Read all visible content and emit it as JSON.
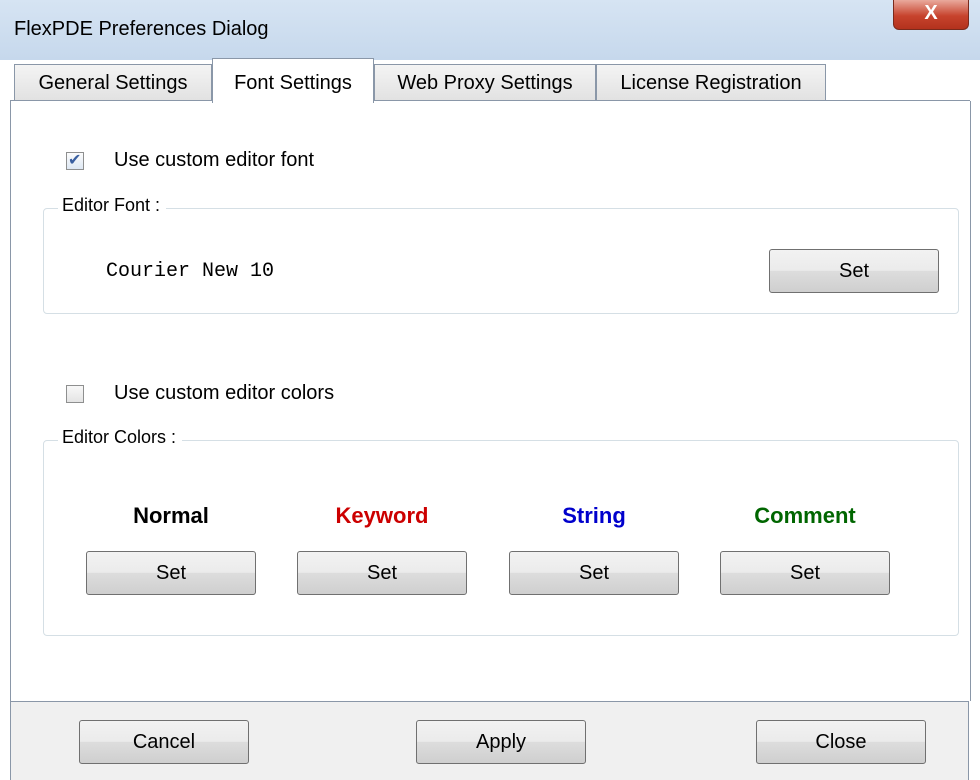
{
  "window": {
    "title": "FlexPDE Preferences Dialog",
    "close_glyph": "X"
  },
  "tabs": [
    {
      "label": "General Settings",
      "active": false
    },
    {
      "label": "Font Settings",
      "active": true
    },
    {
      "label": "Web Proxy Settings",
      "active": false
    },
    {
      "label": "License Registration",
      "active": false
    }
  ],
  "font_settings": {
    "custom_font_checkbox": {
      "label": "Use custom editor font",
      "checked": true
    },
    "editor_font_group": {
      "legend": "Editor Font :",
      "current_font": "Courier New 10",
      "set_label": "Set"
    },
    "custom_colors_checkbox": {
      "label": "Use custom editor colors",
      "checked": false
    },
    "editor_colors_group": {
      "legend": "Editor Colors :",
      "colors": [
        {
          "label": "Normal",
          "color": "#000000",
          "set_label": "Set"
        },
        {
          "label": "Keyword",
          "color": "#cc0000",
          "set_label": "Set"
        },
        {
          "label": "String",
          "color": "#0000cc",
          "set_label": "Set"
        },
        {
          "label": "Comment",
          "color": "#006600",
          "set_label": "Set"
        }
      ]
    }
  },
  "footer": {
    "cancel_label": "Cancel",
    "apply_label": "Apply",
    "close_label": "Close"
  }
}
